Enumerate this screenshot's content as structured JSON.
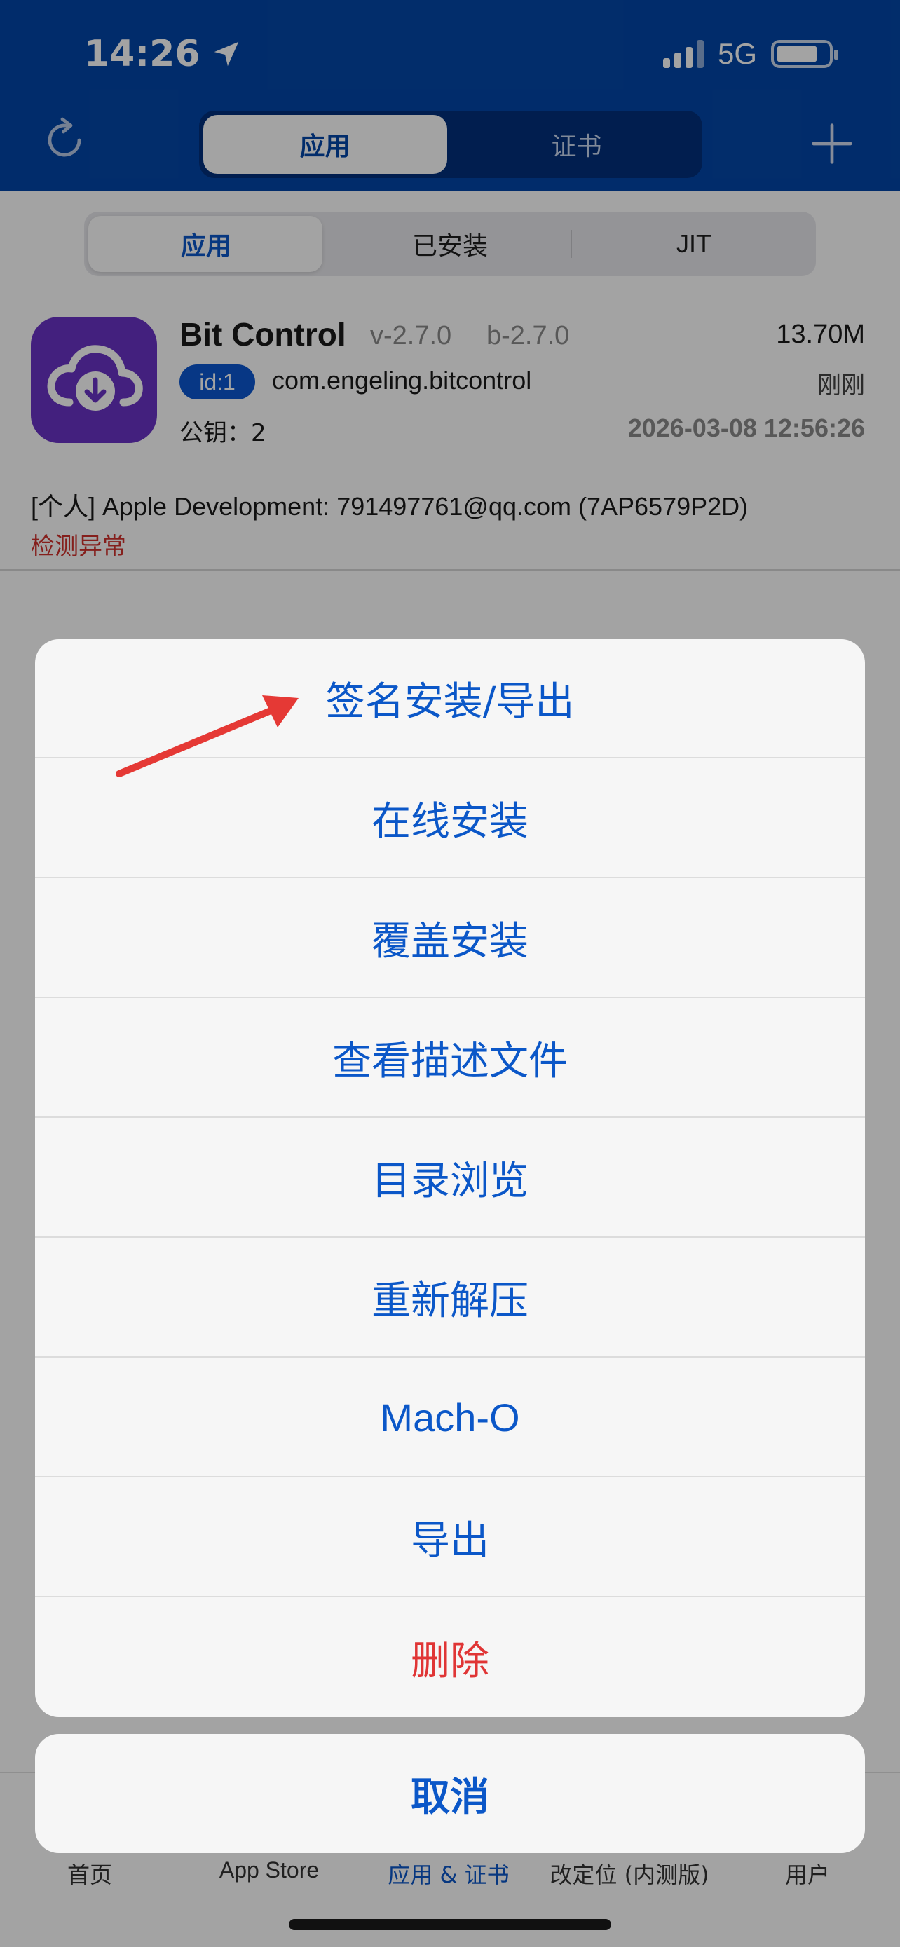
{
  "status_bar": {
    "time": "14:26",
    "network": "5G"
  },
  "header": {
    "segments": [
      {
        "label": "应用",
        "selected": true
      },
      {
        "label": "证书",
        "selected": false
      }
    ]
  },
  "sub_tabs": [
    {
      "label": "应用",
      "selected": true
    },
    {
      "label": "已安装",
      "selected": false
    },
    {
      "label": "JIT",
      "selected": false
    }
  ],
  "app": {
    "name": "Bit Control",
    "version": "v-2.7.0",
    "build": "b-2.7.0",
    "size": "13.70M",
    "id_badge": "id:1",
    "bundle_id": "com.engeling.bitcontrol",
    "install_time": "刚刚",
    "pubkey": "公钥：2",
    "datetime": "2026-03-08 12:56:26",
    "certificate": "[个人] Apple Development: 791497761@qq.com (7AP6579P2D)",
    "warning": "检测异常",
    "icon_color": "#6a32c5"
  },
  "action_sheet": {
    "items": [
      {
        "label": "签名安装/导出",
        "danger": false
      },
      {
        "label": "在线安装",
        "danger": false
      },
      {
        "label": "覆盖安装",
        "danger": false
      },
      {
        "label": "查看描述文件",
        "danger": false
      },
      {
        "label": "目录浏览",
        "danger": false
      },
      {
        "label": "重新解压",
        "danger": false
      },
      {
        "label": "Mach-O",
        "danger": false
      },
      {
        "label": "导出",
        "danger": false
      },
      {
        "label": "删除",
        "danger": true
      }
    ],
    "cancel": "取消"
  },
  "tab_bar": {
    "items": [
      {
        "label": "首页"
      },
      {
        "label": "App Store"
      },
      {
        "label": "应用 & 证书",
        "selected": true
      },
      {
        "label": "改定位 (内测版)"
      },
      {
        "label": "用户"
      }
    ]
  },
  "colors": {
    "header_bg": "#0346a8",
    "accent": "#0b57c8",
    "danger": "#e03535",
    "annotation_arrow": "#e53935"
  }
}
